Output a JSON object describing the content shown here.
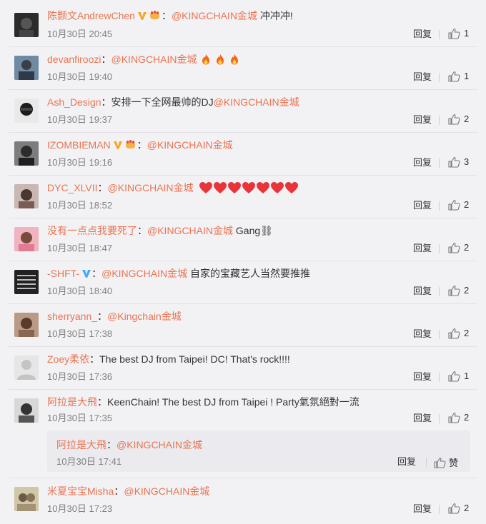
{
  "comments": [
    {
      "user": "陈颢文AndrewChen",
      "badge": "gold-v",
      "emoji": "fist",
      "mention": "@KINGCHAIN金城",
      "text": "冲冲冲!",
      "time": "10月30日 20:45",
      "reply": "回复",
      "likes": "1"
    },
    {
      "user": "devanfiroozi",
      "mention": "@KINGCHAIN金城",
      "text": "",
      "fires": 3,
      "time": "10月30日 19:40",
      "reply": "回复",
      "likes": "1"
    },
    {
      "user": "Ash_Design",
      "prefix": "安排一下全网最帅的DJ",
      "mention": "@KINGCHAIN金城",
      "text": "",
      "time": "10月30日 19:37",
      "reply": "回复",
      "likes": "2"
    },
    {
      "user": "IZOMBIEMAN",
      "badge": "gold-v",
      "emoji": "fist",
      "mention": "@KINGCHAIN金城",
      "text": "",
      "time": "10月30日 19:16",
      "reply": "回复",
      "likes": "3"
    },
    {
      "user": "DYC_XLVII",
      "mention": "@KINGCHAIN金城",
      "text": "",
      "hearts": 7,
      "time": "10月30日 18:52",
      "reply": "回复",
      "likes": "2"
    },
    {
      "user": "没有一点点我要死了",
      "mention": "@KINGCHAIN金城",
      "text": "Gang⛓",
      "time": "10月30日 18:47",
      "reply": "回复",
      "likes": "2"
    },
    {
      "user": "-SHFT-",
      "badge": "blue-v",
      "mention": "@KINGCHAIN金城",
      "text": "自家的宝藏艺人当然要推推",
      "time": "10月30日 18:40",
      "reply": "回复",
      "likes": "2"
    },
    {
      "user": "sherryann_",
      "mention": "@Kingchain金城",
      "text": "",
      "time": "10月30日 17:38",
      "reply": "回复",
      "likes": "2"
    },
    {
      "user": "Zoey柔依",
      "text": "The best DJ from Taipei! DC! That's rock!!!!",
      "time": "10月30日 17:36",
      "reply": "回复",
      "likes": "1"
    },
    {
      "user": "阿拉是大飛",
      "text": "KeenChain! The best DJ from Taipei ! Party氣氛絕對一流",
      "time": "10月30日 17:35",
      "reply": "回复",
      "likes": "2"
    },
    {
      "user": "米夏宝宝Misha",
      "mention": "@KINGCHAIN金城",
      "text": "",
      "time": "10月30日 17:23",
      "reply": "回复",
      "likes": "2"
    }
  ],
  "subreply": {
    "user": "阿拉是大飛",
    "mention": "@KINGCHAIN金城",
    "time": "10月30日 17:41",
    "reply": "回复",
    "like_label": "赞"
  },
  "colors": {
    "username": "#eb7350",
    "text": "#333333",
    "time": "#808080",
    "background": "#f2f2f5"
  }
}
